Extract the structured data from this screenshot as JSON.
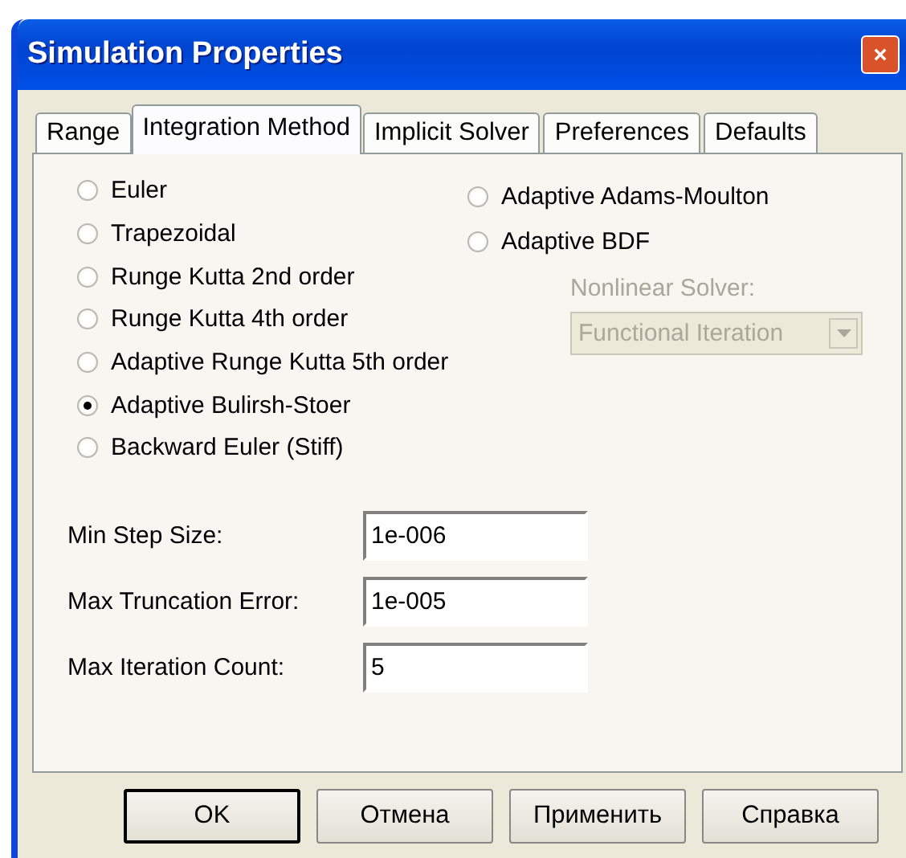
{
  "window": {
    "title": "Simulation Properties"
  },
  "tabs": [
    {
      "label": "Range",
      "selected": false
    },
    {
      "label": "Integration Method",
      "selected": true
    },
    {
      "label": "Implicit Solver",
      "selected": false
    },
    {
      "label": "Preferences",
      "selected": false
    },
    {
      "label": "Defaults",
      "selected": false
    }
  ],
  "methods_left": [
    {
      "label": "Euler",
      "selected": false
    },
    {
      "label": "Trapezoidal",
      "selected": false
    },
    {
      "label": "Runge Kutta 2nd order",
      "selected": false
    },
    {
      "label": "Runge Kutta 4th order",
      "selected": false
    },
    {
      "label": "Adaptive Runge Kutta 5th order",
      "selected": false
    },
    {
      "label": "Adaptive Bulirsh-Stoer",
      "selected": true
    },
    {
      "label": "Backward Euler (Stiff)",
      "selected": false
    }
  ],
  "methods_right": [
    {
      "label": "Adaptive Adams-Moulton",
      "selected": false
    },
    {
      "label": "Adaptive BDF",
      "selected": false
    }
  ],
  "nonlinear_solver": {
    "label": "Nonlinear Solver:",
    "value": "Functional Iteration",
    "disabled": true
  },
  "fields": [
    {
      "label": "Min Step Size:",
      "value": "1e-006"
    },
    {
      "label": "Max Truncation Error:",
      "value": "1e-005"
    },
    {
      "label": "Max Iteration Count:",
      "value": "5"
    }
  ],
  "buttons": [
    {
      "label": "OK",
      "default": true
    },
    {
      "label": "Отмена",
      "default": false
    },
    {
      "label": "Применить",
      "default": false
    },
    {
      "label": "Справка",
      "default": false
    }
  ]
}
